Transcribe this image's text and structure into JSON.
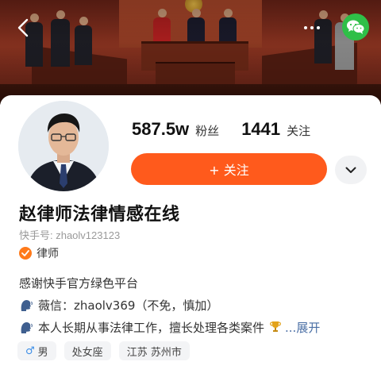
{
  "header": {
    "back_icon": "chevron-left-icon",
    "more_icon": "more-dots-icon",
    "share_icon": "wechat-icon"
  },
  "profile": {
    "stats": [
      {
        "value": "587.5w",
        "label": "粉丝"
      },
      {
        "value": "1441",
        "label": "关注"
      }
    ],
    "follow_label": "+ 关注",
    "follow_color": "#ff5a1c",
    "name": "赵律师法律情感在线",
    "kuaishou_id": "快手号: zhaolv123123",
    "verified_label": "律师",
    "bio": {
      "line1": "感谢快手官方绿色平台",
      "line2": "薇信：zhaolv369（不免，慎加）",
      "line3": "本人长期从事法律工作，擅长处理各类案件",
      "more_label": "...展开"
    },
    "tags": {
      "gender": "男",
      "zodiac": "处女座",
      "location": "江苏 苏州市"
    }
  }
}
